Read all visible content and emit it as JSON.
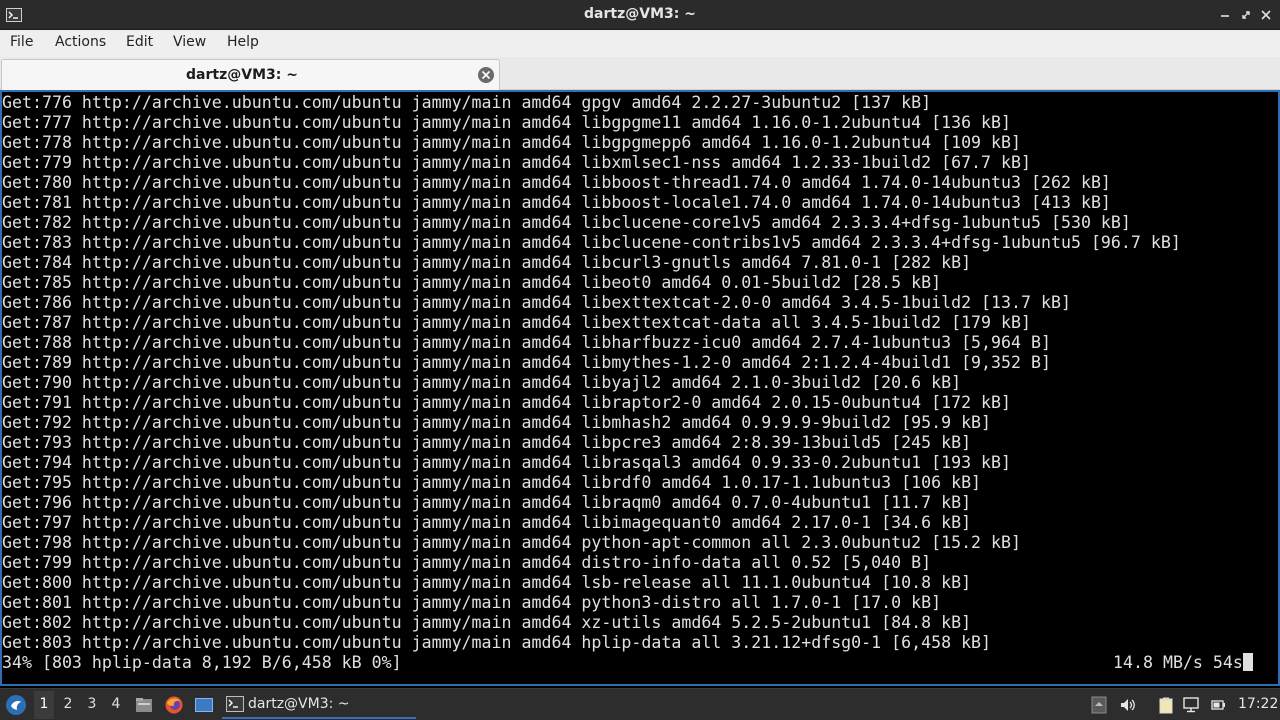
{
  "window": {
    "title": "dartz@VM3: ~"
  },
  "menu": {
    "items": [
      "File",
      "Actions",
      "Edit",
      "View",
      "Help"
    ]
  },
  "tab": {
    "label": "dartz@VM3: ~"
  },
  "terminal": {
    "lines": [
      "Get:776 http://archive.ubuntu.com/ubuntu jammy/main amd64 gpgv amd64 2.2.27-3ubuntu2 [137 kB]",
      "Get:777 http://archive.ubuntu.com/ubuntu jammy/main amd64 libgpgme11 amd64 1.16.0-1.2ubuntu4 [136 kB]",
      "Get:778 http://archive.ubuntu.com/ubuntu jammy/main amd64 libgpgmepp6 amd64 1.16.0-1.2ubuntu4 [109 kB]",
      "Get:779 http://archive.ubuntu.com/ubuntu jammy/main amd64 libxmlsec1-nss amd64 1.2.33-1build2 [67.7 kB]",
      "Get:780 http://archive.ubuntu.com/ubuntu jammy/main amd64 libboost-thread1.74.0 amd64 1.74.0-14ubuntu3 [262 kB]",
      "Get:781 http://archive.ubuntu.com/ubuntu jammy/main amd64 libboost-locale1.74.0 amd64 1.74.0-14ubuntu3 [413 kB]",
      "Get:782 http://archive.ubuntu.com/ubuntu jammy/main amd64 libclucene-core1v5 amd64 2.3.3.4+dfsg-1ubuntu5 [530 kB]",
      "Get:783 http://archive.ubuntu.com/ubuntu jammy/main amd64 libclucene-contribs1v5 amd64 2.3.3.4+dfsg-1ubuntu5 [96.7 kB]",
      "Get:784 http://archive.ubuntu.com/ubuntu jammy/main amd64 libcurl3-gnutls amd64 7.81.0-1 [282 kB]",
      "Get:785 http://archive.ubuntu.com/ubuntu jammy/main amd64 libeot0 amd64 0.01-5build2 [28.5 kB]",
      "Get:786 http://archive.ubuntu.com/ubuntu jammy/main amd64 libexttextcat-2.0-0 amd64 3.4.5-1build2 [13.7 kB]",
      "Get:787 http://archive.ubuntu.com/ubuntu jammy/main amd64 libexttextcat-data all 3.4.5-1build2 [179 kB]",
      "Get:788 http://archive.ubuntu.com/ubuntu jammy/main amd64 libharfbuzz-icu0 amd64 2.7.4-1ubuntu3 [5,964 B]",
      "Get:789 http://archive.ubuntu.com/ubuntu jammy/main amd64 libmythes-1.2-0 amd64 2:1.2.4-4build1 [9,352 B]",
      "Get:790 http://archive.ubuntu.com/ubuntu jammy/main amd64 libyajl2 amd64 2.1.0-3build2 [20.6 kB]",
      "Get:791 http://archive.ubuntu.com/ubuntu jammy/main amd64 libraptor2-0 amd64 2.0.15-0ubuntu4 [172 kB]",
      "Get:792 http://archive.ubuntu.com/ubuntu jammy/main amd64 libmhash2 amd64 0.9.9.9-9build2 [95.9 kB]",
      "Get:793 http://archive.ubuntu.com/ubuntu jammy/main amd64 libpcre3 amd64 2:8.39-13build5 [245 kB]",
      "Get:794 http://archive.ubuntu.com/ubuntu jammy/main amd64 librasqal3 amd64 0.9.33-0.2ubuntu1 [193 kB]",
      "Get:795 http://archive.ubuntu.com/ubuntu jammy/main amd64 librdf0 amd64 1.0.17-1.1ubuntu3 [106 kB]",
      "Get:796 http://archive.ubuntu.com/ubuntu jammy/main amd64 libraqm0 amd64 0.7.0-4ubuntu1 [11.7 kB]",
      "Get:797 http://archive.ubuntu.com/ubuntu jammy/main amd64 libimagequant0 amd64 2.17.0-1 [34.6 kB]",
      "Get:798 http://archive.ubuntu.com/ubuntu jammy/main amd64 python-apt-common all 2.3.0ubuntu2 [15.2 kB]",
      "Get:799 http://archive.ubuntu.com/ubuntu jammy/main amd64 distro-info-data all 0.52 [5,040 B]",
      "Get:800 http://archive.ubuntu.com/ubuntu jammy/main amd64 lsb-release all 11.1.0ubuntu4 [10.8 kB]",
      "Get:801 http://archive.ubuntu.com/ubuntu jammy/main amd64 python3-distro all 1.7.0-1 [17.0 kB]",
      "Get:802 http://archive.ubuntu.com/ubuntu jammy/main amd64 xz-utils amd64 5.2.5-2ubuntu1 [84.8 kB]",
      "Get:803 http://archive.ubuntu.com/ubuntu jammy/main amd64 hplip-data all 3.21.12+dfsg0-1 [6,458 kB]"
    ],
    "progress_line": "34% [803 hplip-data 8,192 B/6,458 kB 0%]",
    "speed_line": "14.8 MB/s 54s"
  },
  "taskbar": {
    "workspaces": [
      "1",
      "2",
      "3",
      "4"
    ],
    "active_workspace": "1",
    "task_label": "dartz@VM3: ~",
    "clock": "17:22",
    "icons": [
      "start-menu-icon",
      "file-manager-icon",
      "firefox-icon",
      "desktop-icon",
      "terminal-icon",
      "notes-icon",
      "volume-icon",
      "clipboard-icon",
      "network-icon",
      "power-icon"
    ]
  }
}
